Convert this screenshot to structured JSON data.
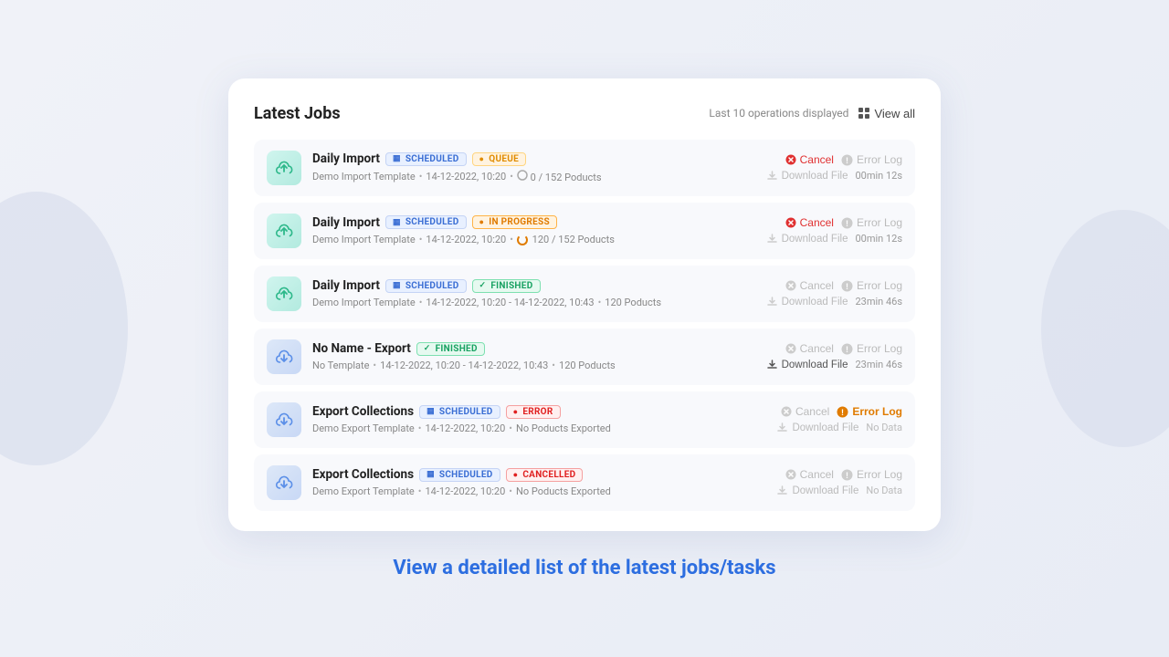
{
  "background": {
    "color": "#f0f2f8"
  },
  "card": {
    "title": "Latest Jobs",
    "header_note": "Last 10 operations displayed",
    "view_all_label": "View all"
  },
  "jobs": [
    {
      "id": "job1",
      "type": "import",
      "name": "Daily Import",
      "badges": [
        {
          "label": "SCHEDULED",
          "type": "scheduled"
        },
        {
          "label": "QUEUE",
          "type": "queue"
        }
      ],
      "template": "Demo Import Template",
      "date": "14-12-2022, 10:20",
      "date_end": null,
      "progress": "0 / 152 Poducts",
      "progress_icon": "circle",
      "cancel": {
        "label": "Cancel",
        "active": true
      },
      "error_log": {
        "label": "Error Log",
        "active": false
      },
      "download": {
        "label": "Download File",
        "active": false
      },
      "time": "00min 12s"
    },
    {
      "id": "job2",
      "type": "import",
      "name": "Daily Import",
      "badges": [
        {
          "label": "SCHEDULED",
          "type": "scheduled"
        },
        {
          "label": "IN PROGRESS",
          "type": "in-progress"
        }
      ],
      "template": "Demo Import Template",
      "date": "14-12-2022, 10:20",
      "date_end": null,
      "progress": "120 / 152 Poducts",
      "progress_icon": "spinner",
      "cancel": {
        "label": "Cancel",
        "active": true
      },
      "error_log": {
        "label": "Error Log",
        "active": false
      },
      "download": {
        "label": "Download File",
        "active": false
      },
      "time": "00min 12s"
    },
    {
      "id": "job3",
      "type": "import",
      "name": "Daily Import",
      "badges": [
        {
          "label": "SCHEDULED",
          "type": "scheduled"
        },
        {
          "label": "FINISHED",
          "type": "finished"
        }
      ],
      "template": "Demo Import Template",
      "date": "14-12-2022, 10:20",
      "date_end": "14-12-2022, 10:43",
      "progress": "120 Poducts",
      "progress_icon": null,
      "cancel": {
        "label": "Cancel",
        "active": false
      },
      "error_log": {
        "label": "Error Log",
        "active": false
      },
      "download": {
        "label": "Download File",
        "active": false
      },
      "time": "23min 46s"
    },
    {
      "id": "job4",
      "type": "export",
      "name": "No Name - Export",
      "badges": [
        {
          "label": "FINISHED",
          "type": "finished"
        }
      ],
      "template": "No Template",
      "date": "14-12-2022, 10:20",
      "date_end": "14-12-2022, 10:43",
      "progress": "120 Poducts",
      "progress_icon": null,
      "cancel": {
        "label": "Cancel",
        "active": false
      },
      "error_log": {
        "label": "Error Log",
        "active": false
      },
      "download": {
        "label": "Download File",
        "active": true
      },
      "time": "23min 46s"
    },
    {
      "id": "job5",
      "type": "export",
      "name": "Export Collections",
      "badges": [
        {
          "label": "SCHEDULED",
          "type": "scheduled"
        },
        {
          "label": "ERROR",
          "type": "error"
        }
      ],
      "template": "Demo Export Template",
      "date": "14-12-2022, 10:20",
      "date_end": null,
      "progress": "No Poducts Exported",
      "progress_icon": null,
      "cancel": {
        "label": "Cancel",
        "active": false
      },
      "error_log": {
        "label": "Error Log",
        "active": true
      },
      "download": {
        "label": "Download File",
        "active": false
      },
      "time": null,
      "no_data": "No Data"
    },
    {
      "id": "job6",
      "type": "export",
      "name": "Export Collections",
      "badges": [
        {
          "label": "SCHEDULED",
          "type": "scheduled"
        },
        {
          "label": "CANCELLED",
          "type": "cancelled"
        }
      ],
      "template": "Demo Export Template",
      "date": "14-12-2022, 10:20",
      "date_end": null,
      "progress": "No Poducts Exported",
      "progress_icon": null,
      "cancel": {
        "label": "Cancel",
        "active": false
      },
      "error_log": {
        "label": "Error Log",
        "active": false
      },
      "download": {
        "label": "Download File",
        "active": false
      },
      "time": null,
      "no_data": "No Data"
    }
  ],
  "bottom_text": "View a detailed list of the latest jobs/tasks"
}
